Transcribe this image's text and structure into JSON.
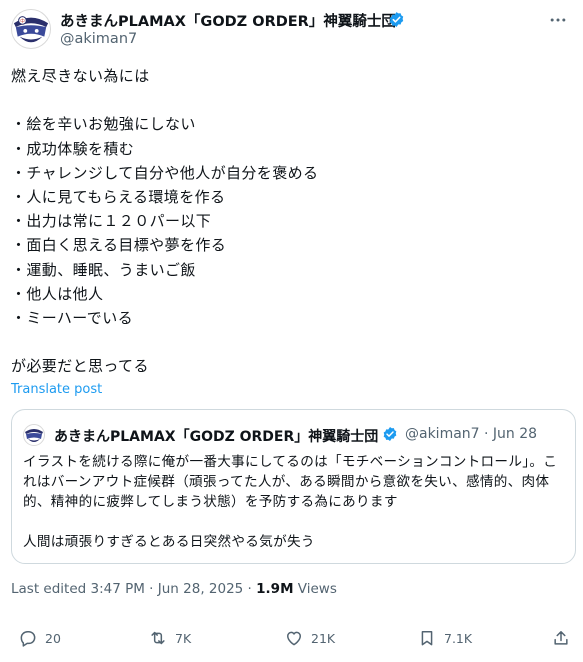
{
  "header": {
    "name": "あきまんPLAMAX「GODZ ORDER」神翼騎士団",
    "handle": "@akiman7"
  },
  "body": {
    "text": "燃え尽きない為には\n\n・絵を辛いお勉強にしない\n・成功体験を積む\n・チャレンジして自分や他人が自分を褒める\n・人に見てもらえる環境を作る\n・出力は常に１２０パー以下\n・面白く思える目標や夢を作る\n・運動、睡眠、うまいご飯\n・他人は他人\n・ミーハーでいる\n\nが必要だと思ってる"
  },
  "translate_label": "Translate post",
  "quote": {
    "name": "あきまんPLAMAX「GODZ ORDER」神翼騎士団",
    "meta": "@akiman7 · Jun 28",
    "para1": "イラストを続ける際に俺が一番大事にしてるのは「モチベーションコントロール」。これはバーンアウト症候群（頑張ってた人が、ある瞬間から意欲を失い、感情的、肉体的、精神的に疲弊してしまう状態）を予防する為にあります",
    "para2": "人間は頑張りすぎるとある日突然やる気が失う"
  },
  "edited": {
    "text": "Last edited 3:47 PM · Jun 28, 2025 · ",
    "views_count": "1.9M",
    "views_label": " Views"
  },
  "actions": {
    "replies": "20",
    "reposts": "7K",
    "likes": "21K",
    "bookmarks": "7.1K"
  },
  "colors": {
    "accent": "#1d9bf0",
    "muted": "#536471",
    "border": "#cfd9de"
  },
  "icons": [
    "avatar",
    "verified-badge-icon",
    "more-icon",
    "reply-icon",
    "repost-icon",
    "like-icon",
    "bookmark-icon",
    "share-icon"
  ]
}
